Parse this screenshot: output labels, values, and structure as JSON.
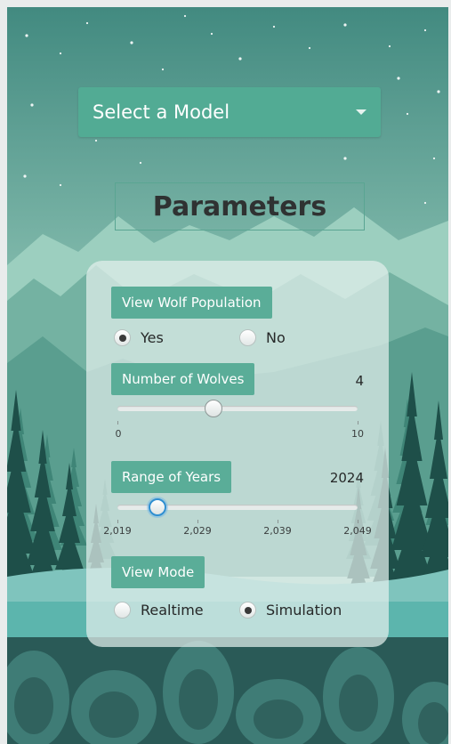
{
  "model_select": {
    "label": "Select a Model",
    "icon": "chevron-down-icon"
  },
  "parameters_title": "Parameters",
  "view_wolf_population": {
    "label": "View Wolf Population",
    "options": [
      "Yes",
      "No"
    ],
    "selected": "Yes"
  },
  "number_of_wolves": {
    "label": "Number of Wolves",
    "value": "4",
    "slider": {
      "min": 0,
      "max": 10,
      "value": 4,
      "tick_labels": [
        "0",
        "10"
      ]
    }
  },
  "range_of_years": {
    "label": "Range of Years",
    "value": "2024",
    "slider": {
      "min": 2019,
      "max": 2049,
      "value": 2024,
      "tick_labels": [
        "2,019",
        "2,029",
        "2,039",
        "2,049"
      ]
    }
  },
  "view_mode": {
    "label": "View Mode",
    "options": [
      "Realtime",
      "Simulation"
    ],
    "selected": "Simulation"
  },
  "colors": {
    "accent": "#52ab94",
    "focus": "#2f8fd1"
  }
}
